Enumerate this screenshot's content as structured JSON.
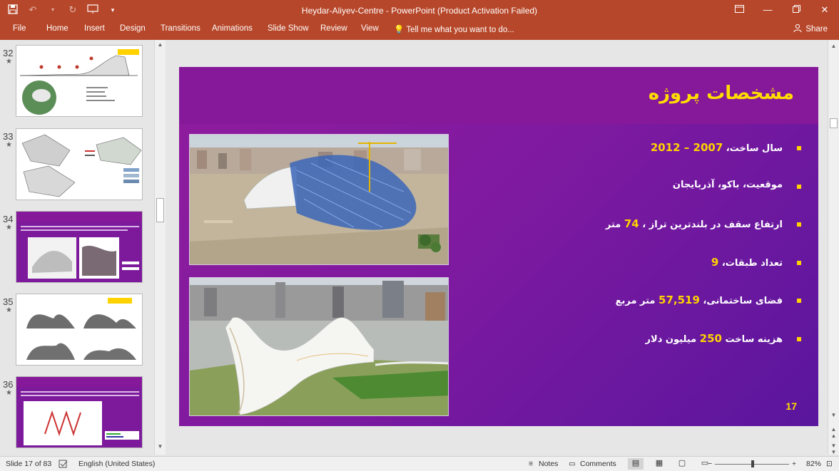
{
  "window": {
    "title": "Heydar-Aliyev-Centre  -  PowerPoint (Product Activation Failed)"
  },
  "qat": {
    "save_icon": "save-icon",
    "undo_icon": "undo-icon",
    "redo_icon": "redo-icon",
    "present_icon": "present-icon",
    "customize_icon": "chevron-down-icon"
  },
  "ribbon": {
    "tabs": [
      "File",
      "Home",
      "Insert",
      "Design",
      "Transitions",
      "Animations",
      "Slide Show",
      "Review",
      "View"
    ],
    "tell_me": "Tell me what you want to do...",
    "share": "Share"
  },
  "thumbnails": [
    {
      "num": "32",
      "mark": "★",
      "kind": "white"
    },
    {
      "num": "33",
      "mark": "★",
      "kind": "white"
    },
    {
      "num": "34",
      "mark": "★",
      "kind": "purple",
      "title": "فرم ها"
    },
    {
      "num": "35",
      "mark": "★",
      "kind": "white"
    },
    {
      "num": "36",
      "mark": "★",
      "kind": "purple",
      "title": "چرخش ها"
    }
  ],
  "slide": {
    "title": "مشخصات پروژه",
    "bullets": [
      {
        "text": "سال ساخت، ",
        "highlight": "2012 – 2007"
      },
      {
        "text": "موقعیت، باکو، آذربایجان",
        "highlight": ""
      },
      {
        "text": "ارتفاع سقف در بلندترین تراز ، ",
        "highlight": "74",
        "suffix": " متر"
      },
      {
        "text": "تعداد طبقات، ",
        "highlight": "9"
      },
      {
        "text": "فضای ساختمانی، ",
        "highlight": "57,519",
        "suffix": " متر مربع"
      },
      {
        "text": "هزینه ساخت ",
        "highlight": "250",
        "suffix": " میلیون دلار"
      }
    ],
    "page_number": "17"
  },
  "status": {
    "slide_info": "Slide 17 of 83",
    "language": "English (United States)",
    "notes": "Notes",
    "comments": "Comments",
    "zoom": "82%",
    "minus": "−",
    "plus": "+"
  },
  "colors": {
    "accent": "#b7472a",
    "slide_purple": "#8a1a9c",
    "highlight": "#ffd200"
  }
}
